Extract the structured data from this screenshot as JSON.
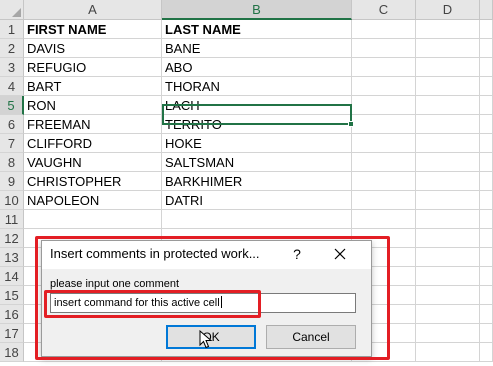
{
  "spreadsheet": {
    "columns": [
      "A",
      "B",
      "C",
      "D"
    ],
    "active_column": "B",
    "active_row": "5",
    "rows": [
      {
        "num": "1",
        "a": "FIRST NAME",
        "b": "LAST NAME"
      },
      {
        "num": "2",
        "a": "DAVIS",
        "b": "BANE"
      },
      {
        "num": "3",
        "a": "REFUGIO",
        "b": "ABO"
      },
      {
        "num": "4",
        "a": "BART",
        "b": "THORAN"
      },
      {
        "num": "5",
        "a": "RON",
        "b": "LACH"
      },
      {
        "num": "6",
        "a": "FREEMAN",
        "b": "TERRITO"
      },
      {
        "num": "7",
        "a": "CLIFFORD",
        "b": "HOKE"
      },
      {
        "num": "8",
        "a": "VAUGHN",
        "b": "SALTSMAN"
      },
      {
        "num": "9",
        "a": "CHRISTOPHER",
        "b": "BARKHIMER"
      },
      {
        "num": "10",
        "a": "NAPOLEON",
        "b": "DATRI"
      },
      {
        "num": "11",
        "a": "",
        "b": ""
      },
      {
        "num": "12",
        "a": "",
        "b": ""
      },
      {
        "num": "13",
        "a": "",
        "b": ""
      },
      {
        "num": "14",
        "a": "",
        "b": ""
      },
      {
        "num": "15",
        "a": "",
        "b": ""
      },
      {
        "num": "16",
        "a": "",
        "b": ""
      },
      {
        "num": "17",
        "a": "",
        "b": ""
      },
      {
        "num": "18",
        "a": "",
        "b": ""
      }
    ]
  },
  "dialog": {
    "title": "Insert comments in protected work...",
    "help_label": "?",
    "label": "please input one comment",
    "input_value": "insert command for this active cell",
    "ok_label": "OK",
    "cancel_label": "Cancel"
  },
  "colors": {
    "accent_green": "#217346",
    "annotation_red": "#e31e24",
    "ok_focus_blue": "#0078d7"
  },
  "icons": {
    "close": "close-icon",
    "cursor": "mouse-pointer-icon"
  }
}
